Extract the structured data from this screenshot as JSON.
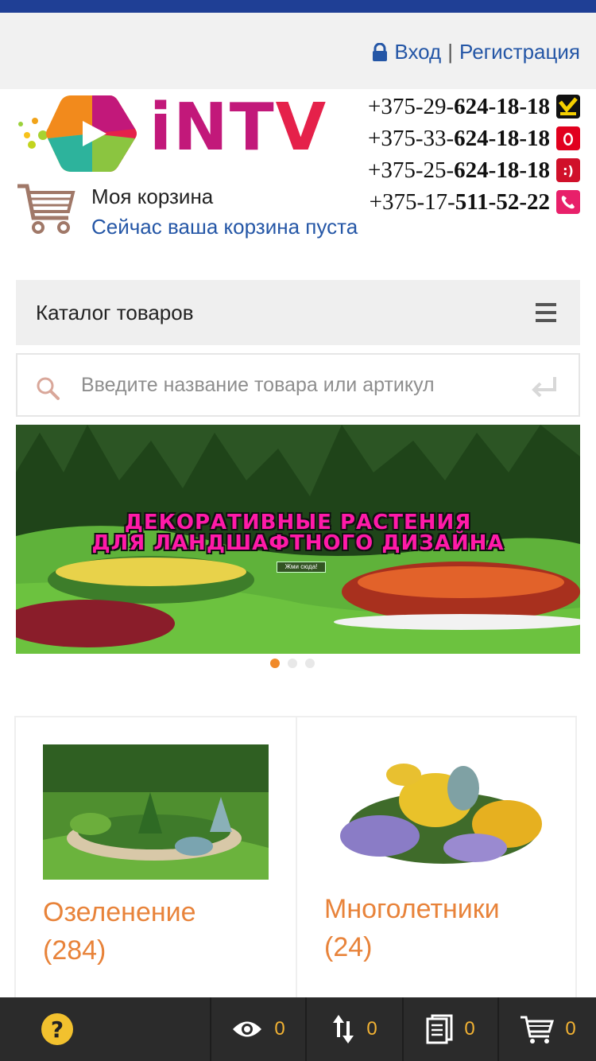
{
  "header": {
    "login": "Вход",
    "separator": "|",
    "register": "Регистрация"
  },
  "logo": {
    "text": "iNTV",
    "text_i": "iNT",
    "text_v": "V"
  },
  "phones": [
    {
      "prefix": "+375-29-",
      "number": "624-18-18",
      "operator": "velcom",
      "operator_color": "#111111"
    },
    {
      "prefix": "+375-33-",
      "number": "624-18-18",
      "operator": "mts",
      "operator_color": "#e1001e"
    },
    {
      "prefix": "+375-25-",
      "number": "624-18-18",
      "operator": "life",
      "operator_color": "#d0102a"
    },
    {
      "prefix": "+375-17-",
      "number": "511-52-22",
      "operator": "landline",
      "operator_color": "#e8206a"
    }
  ],
  "cart": {
    "title": "Моя корзина",
    "status": "Сейчас ваша корзина пуста"
  },
  "catalog": {
    "label": "Каталог товаров"
  },
  "search": {
    "placeholder": "Введите название товара или артикул"
  },
  "banner": {
    "line1": "ДЕКОРАТИВНЫЕ РАСТЕНИЯ",
    "line2": "ДЛЯ ЛАНДШАФТНОГО ДИЗАЙНА",
    "button": "Жми сюда!"
  },
  "slider": {
    "total": 3,
    "active": 1
  },
  "categories": [
    {
      "name": "Озеленение",
      "count": "(284)"
    },
    {
      "name": "Многолетники",
      "count": "(24)"
    }
  ],
  "bottom_bar": {
    "viewed_count": "0",
    "compare_count": "0",
    "list_count": "0",
    "cart_count": "0"
  },
  "colors": {
    "brand_blue": "#1f3f95",
    "link_blue": "#2456a6",
    "accent_orange": "#e8833a",
    "bottom_bar": "#2b2b2b",
    "counter_yellow": "#f2b233"
  }
}
